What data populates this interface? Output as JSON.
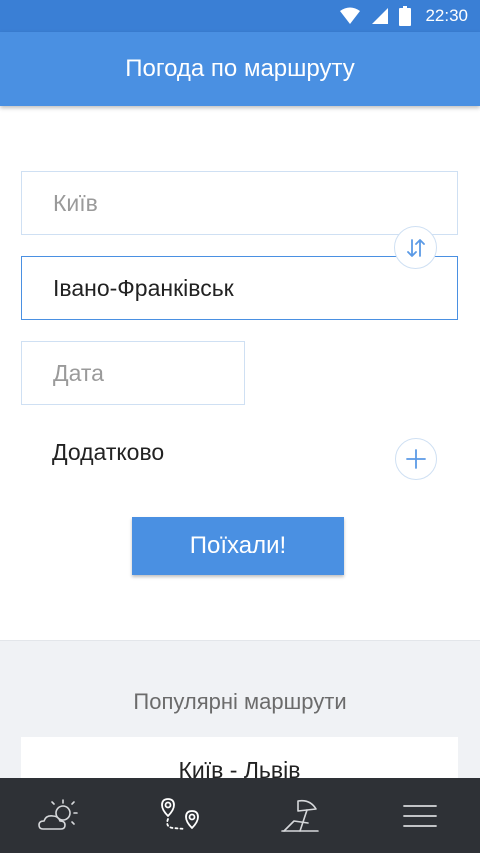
{
  "status_bar": {
    "time": "22:30",
    "icons": [
      "wifi-icon",
      "signal-icon",
      "battery-icon"
    ]
  },
  "app_bar": {
    "title": "Погода по маршруту"
  },
  "form": {
    "from": {
      "value": "",
      "placeholder": "Київ"
    },
    "to": {
      "value": "Івано-Франківськ",
      "placeholder": ""
    },
    "date": {
      "value": "",
      "placeholder": "Дата"
    },
    "swap_icon": "swap-vertical-icon",
    "extra_label": "Додатково",
    "extra_icon": "plus-icon",
    "submit_label": "Поїхали!"
  },
  "popular": {
    "heading": "Популярні маршрути",
    "routes": [
      "Київ - Львів"
    ]
  },
  "bottom_nav": {
    "items": [
      {
        "icon": "weather-icon",
        "active": false
      },
      {
        "icon": "route-icon",
        "active": true
      },
      {
        "icon": "beach-icon",
        "active": false
      },
      {
        "icon": "menu-icon",
        "active": false
      }
    ]
  },
  "colors": {
    "accent": "#4a90e2",
    "status_bar": "#3a7fd5",
    "field_border": "#cfe0f3",
    "nav_bg": "#2e3136",
    "popular_bg": "#f0f2f5"
  }
}
